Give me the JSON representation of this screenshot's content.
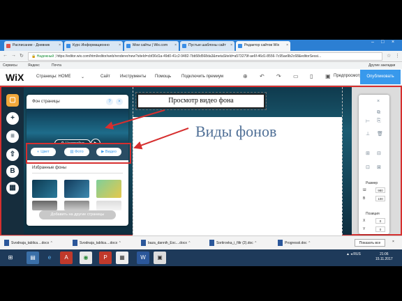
{
  "browser": {
    "tabs": [
      {
        "label": "Расписание - Дневник",
        "color": "#e0554a"
      },
      {
        "label": "Курс Информационно",
        "color": "#3a8ee6"
      },
      {
        "label": "Мои сайты | Wix.com",
        "color": "#3a8ee6"
      },
      {
        "label": "Пустые шаблоны сайт",
        "color": "#3a8ee6"
      },
      {
        "label": "Редактор сайтов Wix",
        "color": "#3a8ee6"
      }
    ],
    "address_security": "Надежный",
    "address_url": "https://editor.wix.com/html/editor/web/renderer/new?siteId=cbf36d1a-49d0-41c2-9482-7bb58d568da3&metaSiteId=a573279f-ae6f-46d1-8556-7c95ae9b2c68&editorSessi...",
    "bookmarks": [
      "Сервисы",
      "Яндекс",
      "Почта",
      "Другие закладки"
    ]
  },
  "wix": {
    "logo": "WiX",
    "page_selector": "Страницы: HOME",
    "menu": [
      "Сайт",
      "Инструменты",
      "Помощь",
      "Подключить премиум"
    ],
    "preview": "Предпросмотр",
    "publish": "Опубликовать"
  },
  "panel": {
    "title": "Фон страницы",
    "help": "?",
    "close": "×",
    "settings": "Настройки",
    "play": "▶",
    "types": [
      "Цвет",
      "Фото",
      "Видео"
    ],
    "favorites_title": "Избранные фоны",
    "add_button": "Добавить на другие страницы"
  },
  "canvas": {
    "heading": "Виды фонов",
    "callout": "Просмотр видео фона"
  },
  "rightbar": {
    "size_label": "Размер",
    "w_label": "Ш",
    "h_label": "В",
    "w_value": "980",
    "h_value": "100",
    "position_label": "Позиция",
    "x_label": "X",
    "y_label": "Y",
    "x_value": "0",
    "y_value": "0"
  },
  "downloads": {
    "files": [
      "Svodnaja_tablica....docx",
      "Svodnaja_tablica....docx",
      "baza_dannih_Exc....docx",
      "Sortirovka_i_filtr (2).doc",
      "Progressii.doc"
    ],
    "show_all": "Показать все"
  },
  "taskbar": {
    "lang": "RUS",
    "time": "21:06",
    "date": "15.11.2017"
  }
}
